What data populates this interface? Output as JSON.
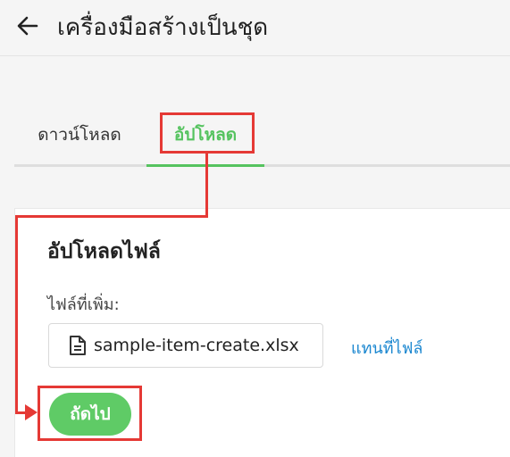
{
  "header": {
    "back_icon": "arrow-left-icon",
    "title": "เครื่องมือสร้างเป็นชุด"
  },
  "tabs": [
    {
      "label": "ดาวน์โหลด",
      "active": false
    },
    {
      "label": "อัปโหลด",
      "active": true
    }
  ],
  "upload": {
    "title": "อัปโหลดไฟล์",
    "file_label": "ไฟล์ที่เพิ่ม:",
    "file_icon": "document-icon",
    "file_name": "sample-item-create.xlsx",
    "replace_label": "แทนที่ไฟล์",
    "next_label": "ถัดไป"
  },
  "colors": {
    "accent_green": "#55c35f",
    "button_green": "#5fcb66",
    "link_blue": "#1b87d0",
    "annotation_red": "#e53935"
  }
}
